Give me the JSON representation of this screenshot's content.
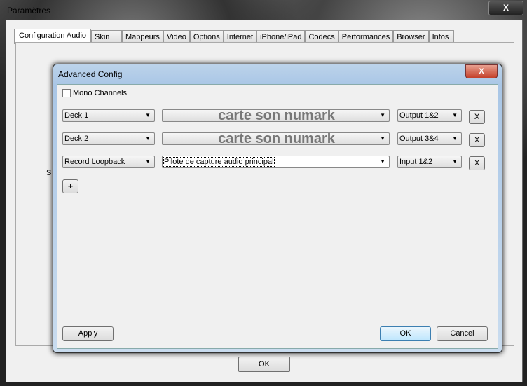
{
  "window": {
    "title": "Paramètres",
    "close": "X",
    "ok": "OK"
  },
  "tabs": [
    "Configuration Audio",
    "Skin",
    "Mappeurs",
    "Video",
    "Options",
    "Internet",
    "iPhone/iPad",
    "Codecs",
    "Performances",
    "Browser",
    "Infos"
  ],
  "hidden_label": "S",
  "dialog": {
    "title": "Advanced Config",
    "close": "X",
    "mono_channels": "Mono Channels",
    "rows": [
      {
        "deck": "Deck 1",
        "device": "carte son numark",
        "output": "Output 1&2",
        "remove": "X"
      },
      {
        "deck": "Deck 2",
        "device": "carte son numark",
        "output": "Output 3&4",
        "remove": "X"
      },
      {
        "deck": "Record Loopback",
        "device": "Pilote de capture audio principal",
        "output": "Input 1&2",
        "remove": "X"
      }
    ],
    "add": "+",
    "apply": "Apply",
    "ok": "OK",
    "cancel": "Cancel"
  }
}
